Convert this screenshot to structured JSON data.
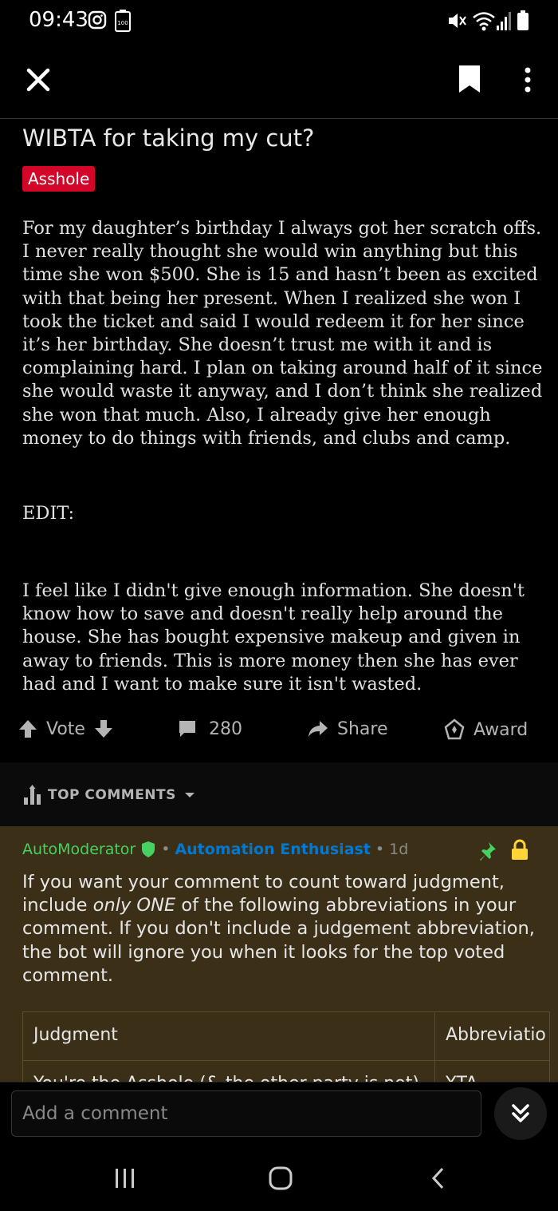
{
  "status_bar": {
    "time": "09:43",
    "battery_label": "100"
  },
  "post": {
    "title": "WIBTA for taking my cut?",
    "flair": "Asshole",
    "paragraph1": "For my daughter’s birthday I always got her scratch offs. I never really thought she would win anything but this time she won $500. She is 15 and hasn’t been as excited with that being her present. When I realized she won I took the ticket and said I would redeem it for her since it’s her birthday. She doesn’t trust me with it and is complaining hard. I plan on taking around half of it since she would waste it anyway, and I don’t think she realized she won that much. Also, I already give her enough money to do things with friends, and clubs and camp.",
    "edit_label": "EDIT:",
    "paragraph2": "I feel like I didn't give enough information. She doesn't know how to save and doesn't really help around the house. She has bought expensive makeup and given in away to friends. This is more money then she has ever had and I want to make sure it isn't wasted."
  },
  "actions": {
    "vote": "Vote",
    "comments_count": "280",
    "share": "Share",
    "award": "Award"
  },
  "comments_header": {
    "sort_label": "TOP COMMENTS"
  },
  "comment": {
    "author": "AutoModerator",
    "author_flair": "Automation Enthusiast",
    "age": "1d",
    "text_part1": "If you want your comment to count toward judgment, include ",
    "text_em1": "only ONE",
    "text_part2": " of the following abbreviations in your comment. If you don't include a judgement abbreviation, the bot will ignore you when it looks for the top voted comment.",
    "table": {
      "headers": [
        "Judgment",
        "Abbreviatio"
      ],
      "rows": [
        [
          "You're the Asshole (& the other party is not)",
          "YTA"
        ]
      ]
    }
  },
  "comment_bar": {
    "placeholder": "Add a comment"
  },
  "colors": {
    "flair_bg": "#d3062a",
    "mod_green": "#46d160",
    "flair_blue": "#0079d3",
    "pin_green": "#46d160",
    "lock_yellow": "#ffd635"
  }
}
